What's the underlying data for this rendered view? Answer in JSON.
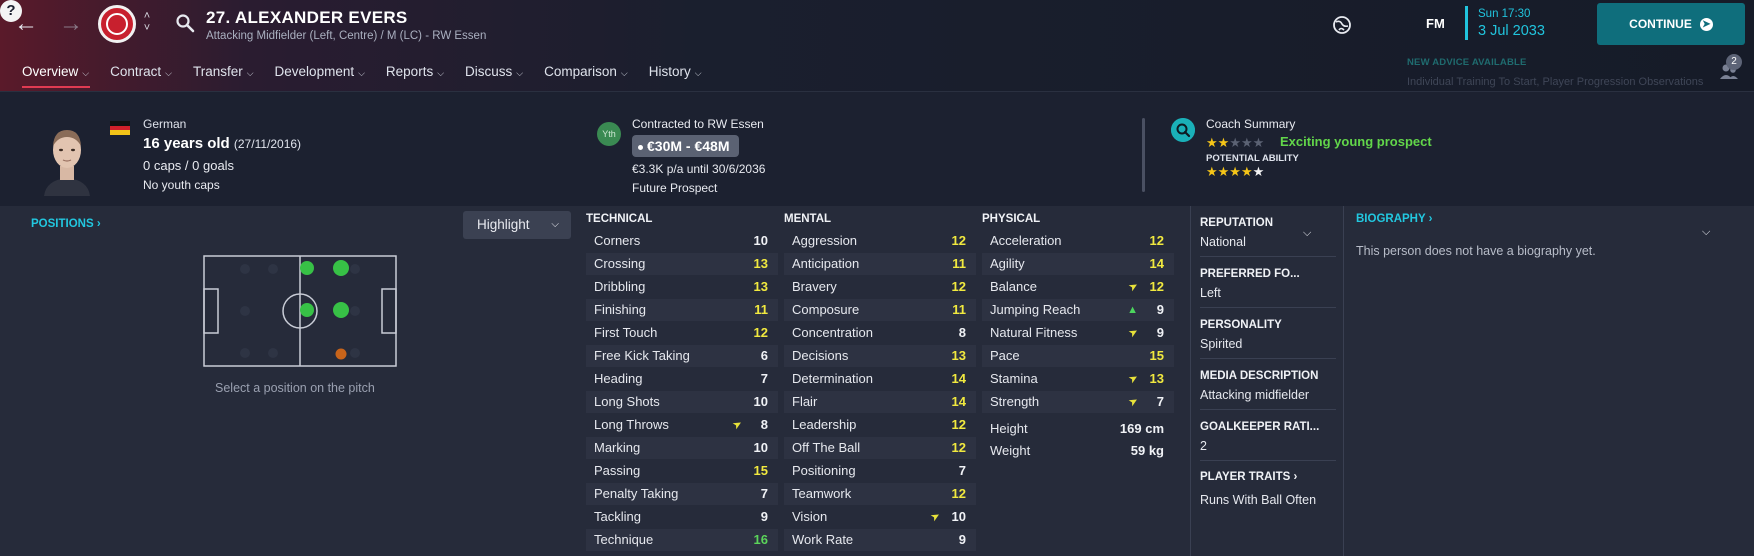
{
  "header": {
    "player_name": "27. ALEXANDER EVERS",
    "player_role": "Attacking Midfielder (Left, Centre) / M (LC) - RW Essen",
    "fm_logo": "FM",
    "date_day": "Sun 17:30",
    "date_full": "3 Jul 2033",
    "continue_label": "CONTINUE"
  },
  "tabs": [
    {
      "label": "Overview",
      "active": true
    },
    {
      "label": "Contract"
    },
    {
      "label": "Transfer"
    },
    {
      "label": "Development"
    },
    {
      "label": "Reports"
    },
    {
      "label": "Discuss"
    },
    {
      "label": "Comparison"
    },
    {
      "label": "History"
    }
  ],
  "advice": {
    "title": "NEW ADVICE AVAILABLE",
    "text": "Individual Training To Start, Player Progression Observations",
    "count": "2"
  },
  "profile": {
    "nationality": "German",
    "age": "16 years old",
    "dob": "(27/11/2016)",
    "caps": "0 caps / 0 goals",
    "youth_caps": "No youth caps"
  },
  "contract": {
    "badge": "Yth",
    "title": "Contracted to RW Essen",
    "value": "€30M - €48M",
    "wage": "€3.3K p/a until 30/6/2036",
    "status": "Future Prospect"
  },
  "coach": {
    "title": "Coach Summary",
    "verdict": "Exciting young prospect",
    "pa_label": "POTENTIAL ABILITY",
    "current_stars": 2,
    "potential_stars": 4.5
  },
  "positions": {
    "title": "POSITIONS",
    "highlight_label": "Highlight",
    "hint": "Select a position on the pitch"
  },
  "attributes": {
    "technical": {
      "title": "TECHNICAL",
      "items": [
        {
          "name": "Corners",
          "value": "10",
          "color": "white"
        },
        {
          "name": "Crossing",
          "value": "13",
          "color": "yellow"
        },
        {
          "name": "Dribbling",
          "value": "13",
          "color": "yellow"
        },
        {
          "name": "Finishing",
          "value": "11",
          "color": "yellow"
        },
        {
          "name": "First Touch",
          "value": "12",
          "color": "yellow"
        },
        {
          "name": "Free Kick Taking",
          "value": "6",
          "color": "white"
        },
        {
          "name": "Heading",
          "value": "7",
          "color": "white"
        },
        {
          "name": "Long Shots",
          "value": "10",
          "color": "white"
        },
        {
          "name": "Long Throws",
          "value": "8",
          "color": "white",
          "arrow": "yellow"
        },
        {
          "name": "Marking",
          "value": "10",
          "color": "white"
        },
        {
          "name": "Passing",
          "value": "15",
          "color": "yellow"
        },
        {
          "name": "Penalty Taking",
          "value": "7",
          "color": "white"
        },
        {
          "name": "Tackling",
          "value": "9",
          "color": "white"
        },
        {
          "name": "Technique",
          "value": "16",
          "color": "green"
        }
      ]
    },
    "mental": {
      "title": "MENTAL",
      "items": [
        {
          "name": "Aggression",
          "value": "12",
          "color": "yellow"
        },
        {
          "name": "Anticipation",
          "value": "11",
          "color": "yellow"
        },
        {
          "name": "Bravery",
          "value": "12",
          "color": "yellow"
        },
        {
          "name": "Composure",
          "value": "11",
          "color": "yellow"
        },
        {
          "name": "Concentration",
          "value": "8",
          "color": "white"
        },
        {
          "name": "Decisions",
          "value": "13",
          "color": "yellow"
        },
        {
          "name": "Determination",
          "value": "14",
          "color": "yellow"
        },
        {
          "name": "Flair",
          "value": "14",
          "color": "yellow"
        },
        {
          "name": "Leadership",
          "value": "12",
          "color": "yellow"
        },
        {
          "name": "Off The Ball",
          "value": "12",
          "color": "yellow"
        },
        {
          "name": "Positioning",
          "value": "7",
          "color": "white"
        },
        {
          "name": "Teamwork",
          "value": "12",
          "color": "yellow"
        },
        {
          "name": "Vision",
          "value": "10",
          "color": "white",
          "arrow": "yellow"
        },
        {
          "name": "Work Rate",
          "value": "9",
          "color": "white"
        }
      ]
    },
    "physical": {
      "title": "PHYSICAL",
      "items": [
        {
          "name": "Acceleration",
          "value": "12",
          "color": "yellow"
        },
        {
          "name": "Agility",
          "value": "14",
          "color": "yellow"
        },
        {
          "name": "Balance",
          "value": "12",
          "color": "yellow",
          "arrow": "yellow"
        },
        {
          "name": "Jumping Reach",
          "value": "9",
          "color": "white",
          "arrow": "green"
        },
        {
          "name": "Natural Fitness",
          "value": "9",
          "color": "white",
          "arrow": "yellow"
        },
        {
          "name": "Pace",
          "value": "15",
          "color": "yellow"
        },
        {
          "name": "Stamina",
          "value": "13",
          "color": "yellow",
          "arrow": "yellow"
        },
        {
          "name": "Strength",
          "value": "7",
          "color": "white",
          "arrow": "yellow"
        }
      ],
      "height_label": "Height",
      "height_value": "169 cm",
      "weight_label": "Weight",
      "weight_value": "59 kg"
    }
  },
  "side_info": {
    "reputation_label": "REPUTATION",
    "reputation_value": "National",
    "foot_label": "PREFERRED FO...",
    "foot_value": "Left",
    "personality_label": "PERSONALITY",
    "personality_value": "Spirited",
    "media_label": "MEDIA DESCRIPTION",
    "media_value": "Attacking midfielder",
    "gk_label": "GOALKEEPER RATI...",
    "gk_value": "2",
    "traits_label": "PLAYER TRAITS",
    "traits_value": "Runs With Ball Often"
  },
  "biography": {
    "title": "BIOGRAPHY",
    "text": "This person does not have a biography yet."
  },
  "colors": {
    "accent_cyan": "#22c8e0",
    "yellow_attr": "#f1e93f",
    "green_attr": "#5bd45a",
    "continue_bg": "#0f6e7c",
    "tab_underline": "#e03b52"
  }
}
